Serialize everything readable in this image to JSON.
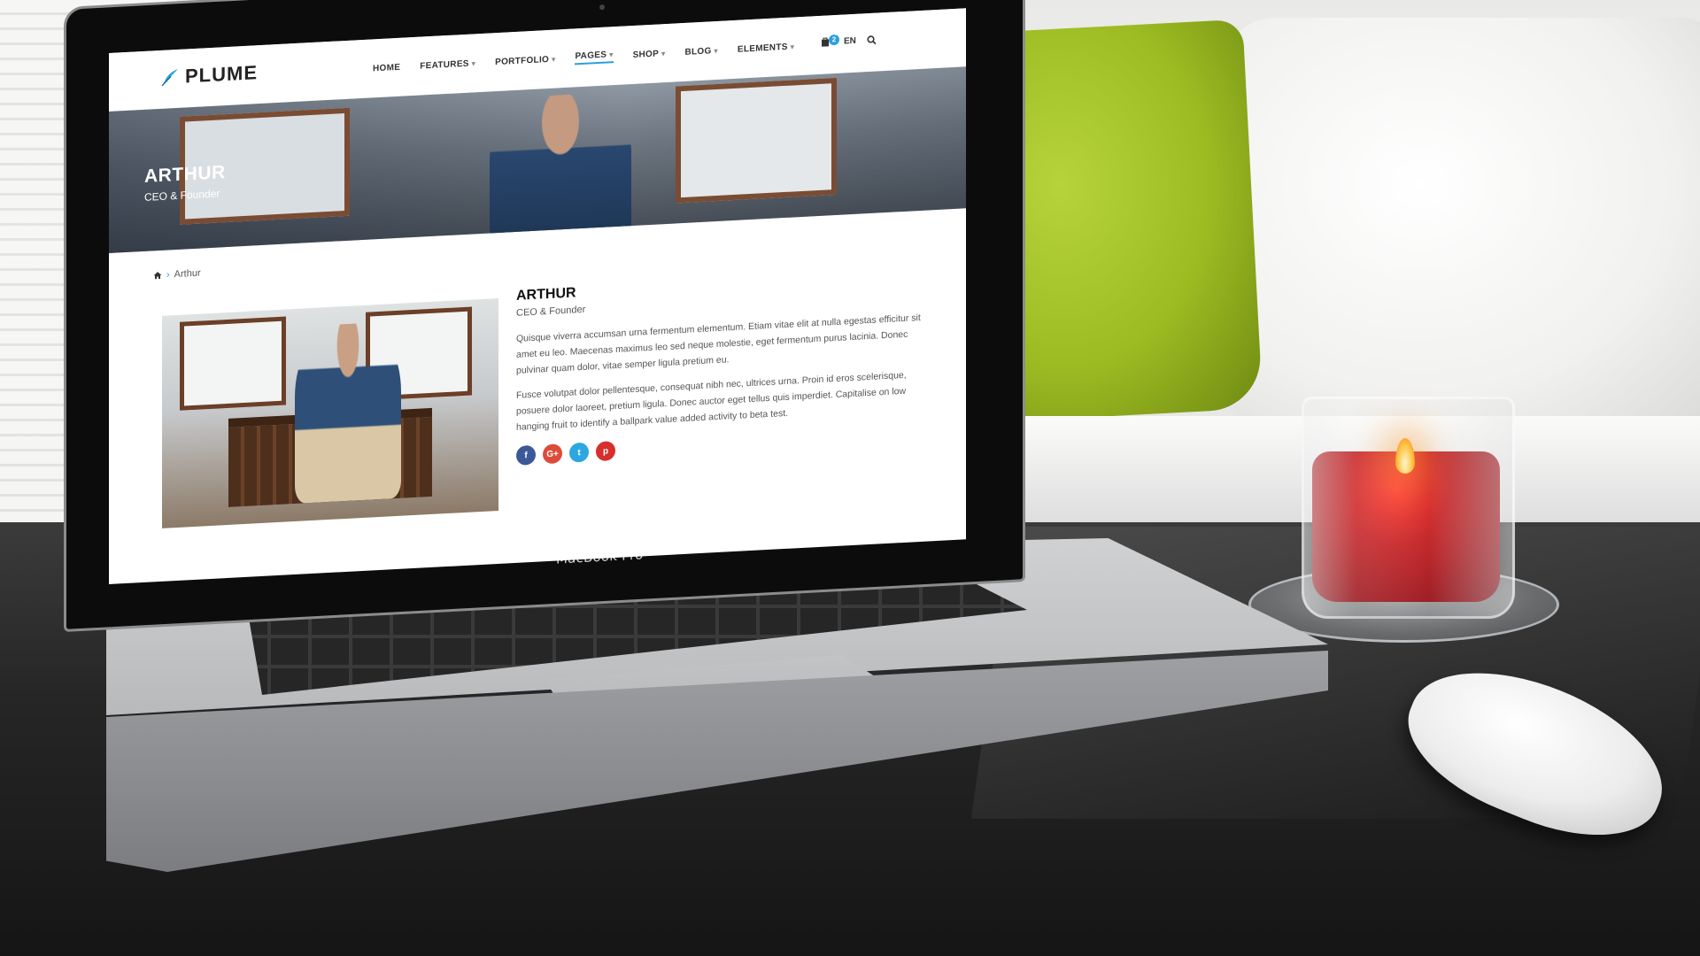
{
  "site": {
    "logo_text": "PLUME",
    "menu": [
      {
        "label": "HOME",
        "dropdown": false
      },
      {
        "label": "FEATURES",
        "dropdown": true
      },
      {
        "label": "PORTFOLIO",
        "dropdown": true
      },
      {
        "label": "PAGES",
        "dropdown": true,
        "active": true
      },
      {
        "label": "SHOP",
        "dropdown": true
      },
      {
        "label": "BLOG",
        "dropdown": true
      },
      {
        "label": "ELEMENTS",
        "dropdown": true
      }
    ],
    "cart_count": "2",
    "language": "EN"
  },
  "hero": {
    "title": "ARTHUR",
    "subtitle": "CEO & Founder"
  },
  "breadcrumb": {
    "current": "Arthur"
  },
  "profile": {
    "name": "ARTHUR",
    "role": "CEO & Founder",
    "paragraph1": "Quisque viverra accumsan urna fermentum elementum. Etiam vitae elit at nulla egestas efficitur sit amet eu leo. Maecenas maximus leo sed neque molestie, eget fermentum purus lacinia. Donec pulvinar quam dolor, vitae semper ligula pretium eu.",
    "paragraph2": "Fusce volutpat dolor pellentesque, consequat nibh nec, ultrices urna. Proin id eros scelerisque, posuere dolor laoreet, pretium ligula. Donec auctor eget tellus quis imperdiet. Capitalise on low hanging fruit to identify a ballpark value added activity to beta test.",
    "socials": [
      {
        "name": "facebook",
        "glyph": "f",
        "color": "#3b5998"
      },
      {
        "name": "google-plus",
        "glyph": "G+",
        "color": "#dd4b39"
      },
      {
        "name": "twitter",
        "glyph": "t",
        "color": "#2ca7e0"
      },
      {
        "name": "pinterest",
        "glyph": "p",
        "color": "#d72e2e"
      }
    ]
  },
  "device": {
    "brand_label": "MacBook Pro"
  },
  "colors": {
    "accent": "#2c9fdf"
  }
}
